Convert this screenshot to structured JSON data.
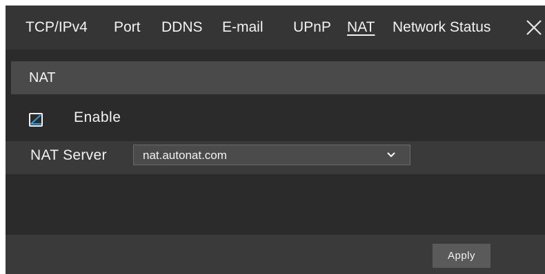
{
  "tabs": [
    {
      "label": "TCP/IPv4",
      "active": false
    },
    {
      "label": "Port",
      "active": false
    },
    {
      "label": "DDNS",
      "active": false
    },
    {
      "label": "E-mail",
      "active": false
    },
    {
      "label": "UPnP",
      "active": false
    },
    {
      "label": "NAT",
      "active": true
    },
    {
      "label": "Network Status",
      "active": false
    }
  ],
  "close_icon": "close-icon",
  "section": {
    "title": "NAT"
  },
  "enable": {
    "label": "Enable",
    "checked": true
  },
  "nat_server": {
    "label": "NAT Server",
    "value": "nat.autonat.com"
  },
  "footer": {
    "apply_label": "Apply"
  },
  "colors": {
    "background": "#2b2b2b",
    "tabbar": "#353535",
    "header": "#4a4a4a",
    "check_accent": "#2e9bd6"
  }
}
